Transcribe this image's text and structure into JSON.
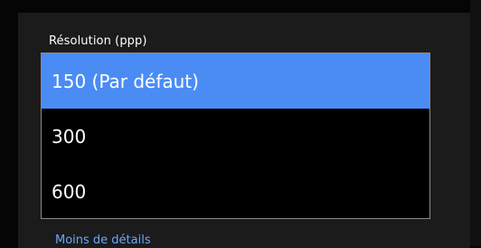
{
  "resolution": {
    "label": "Résolution (ppp)",
    "options": [
      {
        "label": "150 (Par défaut)",
        "selected": true
      },
      {
        "label": "300",
        "selected": false
      },
      {
        "label": "600",
        "selected": false
      }
    ]
  },
  "footer": {
    "less_details_link": "Moins de détails"
  },
  "colors": {
    "selected_option_bg": "#4a8cf4",
    "link": "#6aa6ff"
  }
}
